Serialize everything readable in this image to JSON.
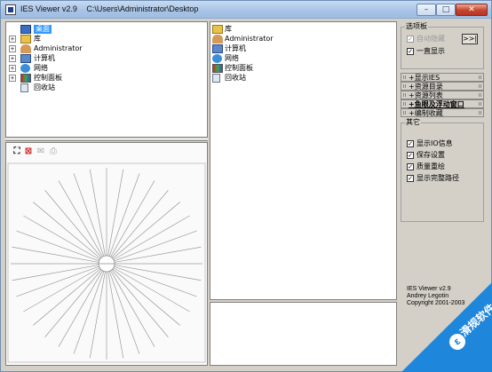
{
  "window": {
    "app_title": "IES Viewer v2.9",
    "path": "C:\\Users\\Administrator\\Desktop",
    "min_glyph": "–",
    "max_glyph": "□",
    "close_glyph": "✕"
  },
  "tree": {
    "items": [
      {
        "label": "桌面",
        "expander": "",
        "icon": "desktop-icon",
        "selected": true
      },
      {
        "label": "库",
        "expander": "+",
        "icon": "library-icon"
      },
      {
        "label": "Administrator",
        "expander": "+",
        "icon": "user-folder-icon"
      },
      {
        "label": "计算机",
        "expander": "+",
        "icon": "computer-icon"
      },
      {
        "label": "网络",
        "expander": "+",
        "icon": "network-icon"
      },
      {
        "label": "控制面板",
        "expander": "+",
        "icon": "control-panel-icon"
      },
      {
        "label": "回收站",
        "expander": "",
        "icon": "recycle-bin-icon"
      }
    ]
  },
  "file_list": {
    "items": [
      {
        "label": "库",
        "icon": "library-icon"
      },
      {
        "label": "Administrator",
        "icon": "user-folder-icon"
      },
      {
        "label": "计算机",
        "icon": "computer-icon"
      },
      {
        "label": "网络",
        "icon": "network-icon"
      },
      {
        "label": "控制面板",
        "icon": "control-panel-icon"
      },
      {
        "label": "回收站",
        "icon": "recycle-bin-icon"
      }
    ]
  },
  "viewer_toolbar": {
    "zoom_glyph": "⛶",
    "pdf_glyph": "⊠",
    "mail_glyph": "✉",
    "print_glyph": "⎙"
  },
  "options": {
    "title": "选项板",
    "auto_hide_label": "自动隐藏",
    "auto_hide_checked": true,
    "always_show_label": "一直显示",
    "always_show_checked": true,
    "more_button": ">>|",
    "check_glyph": "✓"
  },
  "sections": [
    {
      "label": "+显示IES",
      "style": ""
    },
    {
      "label": "+资源目录",
      "style": ""
    },
    {
      "label": "+资源列表",
      "style": ""
    },
    {
      "label": "+鱼眼及浮动窗口",
      "style": "bold ul"
    },
    {
      "label": "+编制收藏",
      "style": ""
    }
  ],
  "other": {
    "title": "其它",
    "items": [
      {
        "label": "显示IO信息",
        "checked": true
      },
      {
        "label": "保存设置",
        "checked": true
      },
      {
        "label": "质量重绘",
        "checked": true
      },
      {
        "label": "显示完整路径",
        "checked": true
      }
    ]
  },
  "about": {
    "line1": "IES Viewer v2.9",
    "line2": "Andrey Legotin",
    "line3": "Copyright 2001-2003"
  },
  "watermark": {
    "logo_glyph": "ε",
    "text": "滑规软件",
    "color": "#1f87db"
  }
}
